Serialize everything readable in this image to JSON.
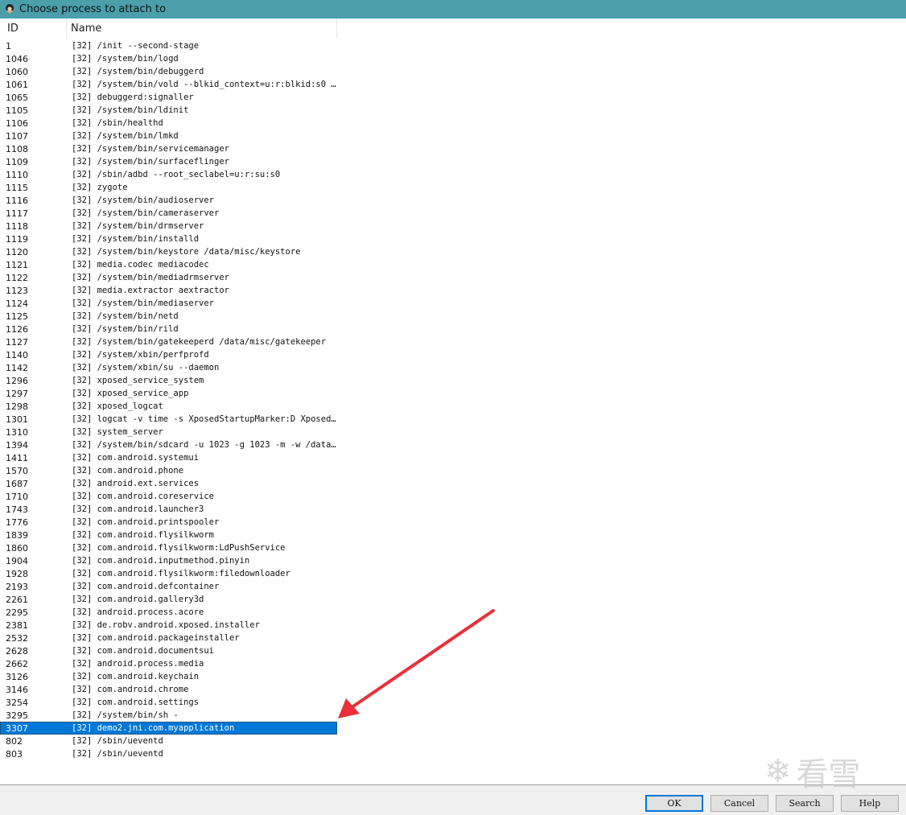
{
  "window": {
    "title": "Choose process to attach to"
  },
  "table": {
    "columns": [
      "ID",
      "Name"
    ],
    "rows": [
      {
        "id": "1",
        "name": "[32] /init --second-stage"
      },
      {
        "id": "1046",
        "name": "[32] /system/bin/logd"
      },
      {
        "id": "1060",
        "name": "[32] /system/bin/debuggerd"
      },
      {
        "id": "1061",
        "name": "[32] /system/bin/vold --blkid_context=u:r:blkid:s0 --..."
      },
      {
        "id": "1065",
        "name": "[32] debuggerd:signaller"
      },
      {
        "id": "1105",
        "name": "[32] /system/bin/ldinit"
      },
      {
        "id": "1106",
        "name": "[32] /sbin/healthd"
      },
      {
        "id": "1107",
        "name": "[32] /system/bin/lmkd"
      },
      {
        "id": "1108",
        "name": "[32] /system/bin/servicemanager"
      },
      {
        "id": "1109",
        "name": "[32] /system/bin/surfaceflinger"
      },
      {
        "id": "1110",
        "name": "[32] /sbin/adbd --root_seclabel=u:r:su:s0"
      },
      {
        "id": "1115",
        "name": "[32] zygote"
      },
      {
        "id": "1116",
        "name": "[32] /system/bin/audioserver"
      },
      {
        "id": "1117",
        "name": "[32] /system/bin/cameraserver"
      },
      {
        "id": "1118",
        "name": "[32] /system/bin/drmserver"
      },
      {
        "id": "1119",
        "name": "[32] /system/bin/installd"
      },
      {
        "id": "1120",
        "name": "[32] /system/bin/keystore /data/misc/keystore"
      },
      {
        "id": "1121",
        "name": "[32] media.codec mediacodec"
      },
      {
        "id": "1122",
        "name": "[32] /system/bin/mediadrmserver"
      },
      {
        "id": "1123",
        "name": "[32] media.extractor aextractor"
      },
      {
        "id": "1124",
        "name": "[32] /system/bin/mediaserver"
      },
      {
        "id": "1125",
        "name": "[32] /system/bin/netd"
      },
      {
        "id": "1126",
        "name": "[32] /system/bin/rild"
      },
      {
        "id": "1127",
        "name": "[32] /system/bin/gatekeeperd /data/misc/gatekeeper"
      },
      {
        "id": "1140",
        "name": "[32] /system/xbin/perfprofd"
      },
      {
        "id": "1142",
        "name": "[32] /system/xbin/su --daemon"
      },
      {
        "id": "1296",
        "name": "[32] xposed_service_system"
      },
      {
        "id": "1297",
        "name": "[32] xposed_service_app"
      },
      {
        "id": "1298",
        "name": "[32] xposed_logcat"
      },
      {
        "id": "1301",
        "name": "[32] logcat -v time -s XposedStartupMarker:D Xposed:..."
      },
      {
        "id": "1310",
        "name": "[32] system_server"
      },
      {
        "id": "1394",
        "name": "[32] /system/bin/sdcard -u 1023 -g 1023 -m -w /data/..."
      },
      {
        "id": "1411",
        "name": "[32] com.android.systemui"
      },
      {
        "id": "1570",
        "name": "[32] com.android.phone"
      },
      {
        "id": "1687",
        "name": "[32] android.ext.services"
      },
      {
        "id": "1710",
        "name": "[32] com.android.coreservice"
      },
      {
        "id": "1743",
        "name": "[32] com.android.launcher3"
      },
      {
        "id": "1776",
        "name": "[32] com.android.printspooler"
      },
      {
        "id": "1839",
        "name": "[32] com.android.flysilkworm"
      },
      {
        "id": "1860",
        "name": "[32] com.android.flysilkworm:LdPushService"
      },
      {
        "id": "1904",
        "name": "[32] com.android.inputmethod.pinyin"
      },
      {
        "id": "1928",
        "name": "[32] com.android.flysilkworm:filedownloader"
      },
      {
        "id": "2193",
        "name": "[32] com.android.defcontainer"
      },
      {
        "id": "2261",
        "name": "[32] com.android.gallery3d"
      },
      {
        "id": "2295",
        "name": "[32] android.process.acore"
      },
      {
        "id": "2381",
        "name": "[32] de.robv.android.xposed.installer"
      },
      {
        "id": "2532",
        "name": "[32] com.android.packageinstaller"
      },
      {
        "id": "2628",
        "name": "[32] com.android.documentsui"
      },
      {
        "id": "2662",
        "name": "[32] android.process.media"
      },
      {
        "id": "3126",
        "name": "[32] com.android.keychain"
      },
      {
        "id": "3146",
        "name": "[32] com.android.chrome"
      },
      {
        "id": "3254",
        "name": "[32] com.android.settings"
      },
      {
        "id": "3295",
        "name": "[32] /system/bin/sh -"
      },
      {
        "id": "3307",
        "name": "[32] demo2.jni.com.myapplication",
        "selected": true
      },
      {
        "id": "802",
        "name": "[32] /sbin/ueventd"
      },
      {
        "id": "803",
        "name": "[32] /sbin/ueventd"
      }
    ]
  },
  "watermark": {
    "text": "看雪"
  },
  "buttons": {
    "ok": "OK",
    "cancel": "Cancel",
    "search": "Search",
    "help": "Help"
  },
  "colors": {
    "titlebar": "#4a9fab",
    "selection": "#0078d7",
    "arrow": "#e8313a"
  }
}
